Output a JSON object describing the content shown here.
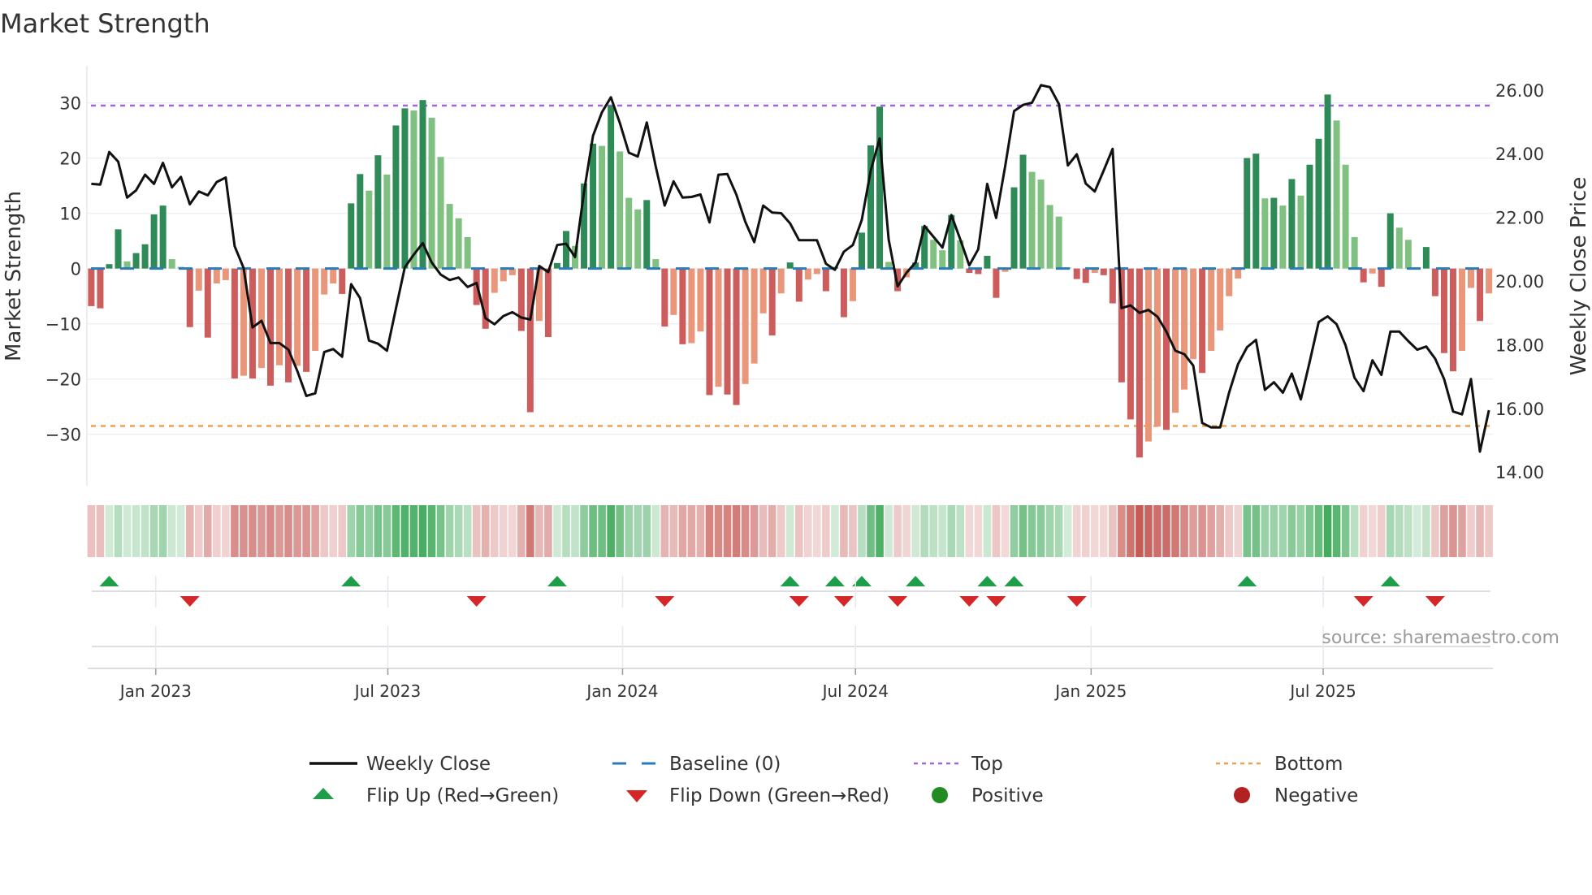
{
  "title": "Market Strength",
  "source": "source: sharemaestro.com",
  "colors": {
    "green_dark": "#2e8b57",
    "green_light": "#80c080",
    "red_dark": "#cd5c5c",
    "red_light": "#e9967a",
    "line": "#111111",
    "baseline": "#2b7bba",
    "top": "#a066e0",
    "bottom": "#f0a050",
    "flip_up": "#1f9e4a",
    "flip_down": "#d62728",
    "positive": "#228b22",
    "negative": "#b22222",
    "band_green": "#3aa655",
    "band_red": "#c65a55"
  },
  "legend": {
    "weekly_close": "Weekly Close",
    "baseline": "Baseline (0)",
    "top": "Top",
    "bottom": "Bottom",
    "flip_up": "Flip Up (Red→Green)",
    "flip_down": "Flip Down (Green→Red)",
    "positive": "Positive",
    "negative": "Negative"
  },
  "chart_data": {
    "type": "bar+line",
    "title": "Market Strength",
    "ylabel": "Market Strength",
    "y2label": "Weekly Close Price",
    "ylim": [
      -39.3,
      36.7
    ],
    "y2lim": [
      13.57,
      26.76
    ],
    "yticks": [
      30,
      20,
      10,
      0,
      -10,
      -20,
      -30
    ],
    "yticklabels": [
      "30",
      "20",
      "10",
      "0",
      "−10",
      "−20",
      "−30"
    ],
    "y2ticks": [
      26,
      24,
      22,
      20,
      18,
      16,
      14
    ],
    "y2ticklabels": [
      "26.00",
      "24.00",
      "22.00",
      "20.00",
      "18.00",
      "16.00",
      "14.00"
    ],
    "xticks": [
      {
        "label": "Jan 2023",
        "week": 7.2
      },
      {
        "label": "Jul 2023",
        "week": 33.1
      },
      {
        "label": "Jan 2024",
        "week": 59.3
      },
      {
        "label": "Jul 2024",
        "week": 85.3
      },
      {
        "label": "Jan 2025",
        "week": 111.6
      },
      {
        "label": "Jul 2025",
        "week": 137.5
      }
    ],
    "top_threshold": 29.5,
    "bottom_threshold": -28.5,
    "baseline": 0,
    "grid": true,
    "legend_position": "bottom",
    "strength": [
      -6.8,
      -7.2,
      0.8,
      7.1,
      1.3,
      2.8,
      4.4,
      9.8,
      11.4,
      1.7,
      0.3,
      -10.6,
      -4.0,
      -12.5,
      -2.7,
      -2.1,
      -19.9,
      -19.4,
      -19.9,
      -18.0,
      -21.2,
      -17.5,
      -20.6,
      -17.6,
      -18.7,
      -14.9,
      -4.7,
      -2.7,
      -4.6,
      11.8,
      17.1,
      14.1,
      20.5,
      17.0,
      25.9,
      29.0,
      28.6,
      30.5,
      27.3,
      20.2,
      11.7,
      9.1,
      5.7,
      -6.6,
      -10.9,
      -4.4,
      -2.3,
      -1.2,
      -11.3,
      -26.0,
      -9.5,
      -12.4,
      1.0,
      6.8,
      4.1,
      15.4,
      22.6,
      22.2,
      29.5,
      21.2,
      12.8,
      10.7,
      12.4,
      1.7,
      -10.5,
      -8.4,
      -13.7,
      -13.5,
      -11.4,
      -22.9,
      -21.4,
      -22.8,
      -24.7,
      -20.9,
      -17.2,
      -8.1,
      -12.1,
      -4.5,
      1.1,
      -6.0,
      -2.0,
      -1.0,
      -4.1,
      0.3,
      -8.8,
      -5.9,
      6.5,
      22.3,
      29.3,
      1.2,
      -4.1,
      -1.6,
      1.1,
      7.7,
      5.2,
      3.3,
      9.7,
      5.1,
      -0.8,
      -1.0,
      2.3,
      -5.3,
      -0.6,
      14.7,
      20.6,
      17.5,
      16.1,
      11.5,
      9.4,
      0.2,
      -1.9,
      -2.6,
      -0.8,
      -1.2,
      -6.3,
      -20.6,
      -27.3,
      -34.2,
      -31.3,
      -28.6,
      -29.2,
      -26.1,
      -21.9,
      -16.4,
      -18.9,
      -14.9,
      -11.2,
      -5.0,
      -1.8,
      20.0,
      20.8,
      12.7,
      12.8,
      11.4,
      16.2,
      13.2,
      18.8,
      23.5,
      31.5,
      26.8,
      18.8,
      5.7,
      -2.5,
      -0.9,
      -3.3,
      10.0,
      7.4,
      5.2,
      0.2,
      3.9,
      -5.0,
      -15.3,
      -18.6,
      -14.9,
      -3.5,
      -9.5,
      -4.5
    ],
    "weekly_close": [
      23.05,
      23.03,
      24.05,
      23.75,
      22.62,
      22.85,
      23.34,
      23.05,
      23.71,
      22.94,
      23.27,
      22.41,
      22.81,
      22.69,
      23.11,
      23.25,
      21.09,
      20.41,
      18.54,
      18.75,
      18.05,
      18.05,
      17.84,
      17.17,
      16.39,
      16.47,
      17.77,
      17.86,
      17.62,
      19.9,
      19.46,
      18.13,
      18.03,
      17.81,
      19.13,
      20.43,
      20.83,
      21.19,
      20.58,
      20.2,
      20.03,
      20.11,
      19.81,
      19.94,
      18.83,
      18.64,
      18.9,
      19.02,
      18.85,
      18.79,
      20.47,
      20.28,
      21.13,
      21.17,
      20.75,
      22.79,
      24.56,
      25.3,
      25.77,
      24.96,
      24.03,
      23.91,
      24.98,
      23.6,
      22.37,
      23.13,
      22.62,
      22.64,
      22.72,
      21.84,
      23.34,
      23.36,
      22.71,
      21.86,
      21.22,
      22.37,
      22.15,
      22.13,
      21.81,
      21.28,
      21.28,
      21.28,
      20.54,
      20.35,
      20.92,
      21.13,
      21.92,
      23.47,
      24.48,
      21.3,
      19.83,
      20.26,
      20.58,
      21.73,
      21.39,
      21.05,
      22.07,
      21.3,
      20.49,
      21.0,
      23.05,
      21.98,
      23.6,
      25.34,
      25.53,
      25.6,
      26.15,
      26.09,
      25.56,
      23.63,
      23.98,
      23.06,
      22.81,
      23.47,
      24.15,
      19.15,
      19.23,
      19.0,
      19.09,
      18.88,
      18.41,
      17.81,
      17.7,
      17.34,
      15.54,
      15.4,
      15.4,
      16.49,
      17.39,
      17.92,
      18.15,
      16.58,
      16.82,
      16.49,
      17.09,
      16.28,
      17.47,
      18.71,
      18.89,
      18.64,
      17.98,
      16.96,
      16.54,
      17.51,
      17.05,
      18.41,
      18.41,
      18.11,
      17.84,
      17.94,
      17.56,
      16.92,
      15.9,
      15.81,
      16.92,
      14.64,
      15.94
    ]
  }
}
